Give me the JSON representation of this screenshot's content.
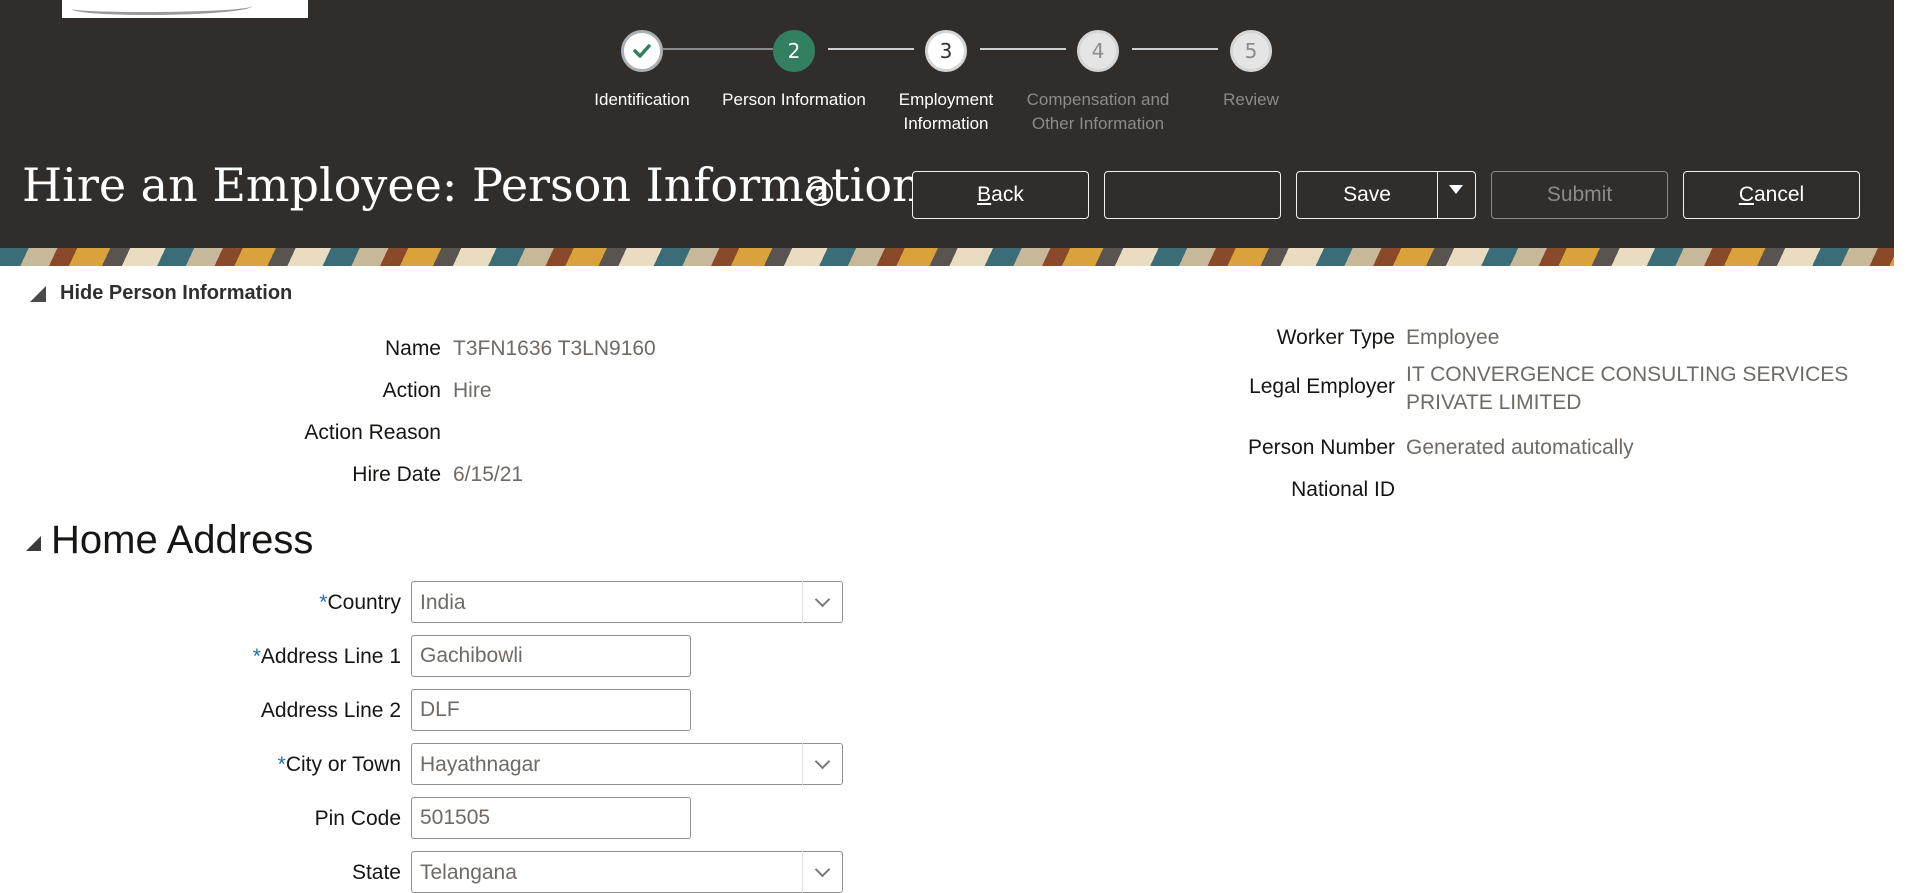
{
  "header": {
    "title": "Hire an Employee: Person Information",
    "help_icon": "?",
    "buttons": {
      "back": "Back",
      "blank": "",
      "save": "Save",
      "submit": "Submit",
      "cancel": "Cancel"
    }
  },
  "train": {
    "steps": [
      {
        "number": "✓",
        "label": "Identification",
        "state": "done"
      },
      {
        "number": "2",
        "label": "Person Information",
        "state": "current"
      },
      {
        "number": "3",
        "label": "Employment\nInformation",
        "state": "next"
      },
      {
        "number": "4",
        "label": "Compensation and\nOther Information",
        "state": "future"
      },
      {
        "number": "5",
        "label": "Review",
        "state": "future"
      }
    ]
  },
  "person_info": {
    "toggle_label": "Hide Person Information",
    "left": [
      {
        "label": "Name",
        "value": "T3FN1636 T3LN9160"
      },
      {
        "label": "Action",
        "value": "Hire"
      },
      {
        "label": "Action Reason",
        "value": ""
      },
      {
        "label": "Hire Date",
        "value": "6/15/21"
      }
    ],
    "right": [
      {
        "label": "Worker Type",
        "value": "Employee"
      },
      {
        "label": "Legal Employer",
        "value": "IT CONVERGENCE CONSULTING SERVICES PRIVATE LIMITED"
      },
      {
        "label": "Person Number",
        "value": "Generated automatically"
      },
      {
        "label": "National ID",
        "value": ""
      }
    ]
  },
  "home_address": {
    "title": "Home Address",
    "required_marker": "*",
    "fields": {
      "country": {
        "label": "Country",
        "value": "India"
      },
      "address1": {
        "label": "Address Line 1",
        "value": "Gachibowli"
      },
      "address2": {
        "label": "Address Line 2",
        "value": "DLF"
      },
      "city": {
        "label": "City or Town",
        "value": "Hayathnagar"
      },
      "pin": {
        "label": "Pin Code",
        "value": "501505"
      },
      "state": {
        "label": "State",
        "value": "Telangana"
      }
    }
  },
  "colors": {
    "header_bg": "#312d2a",
    "current_step": "#338060",
    "required": "#1d6fb8"
  },
  "icons": [
    "check-icon",
    "help-icon",
    "dropdown-arrow-icon",
    "collapse-triangle-icon",
    "chevron-down-icon"
  ]
}
